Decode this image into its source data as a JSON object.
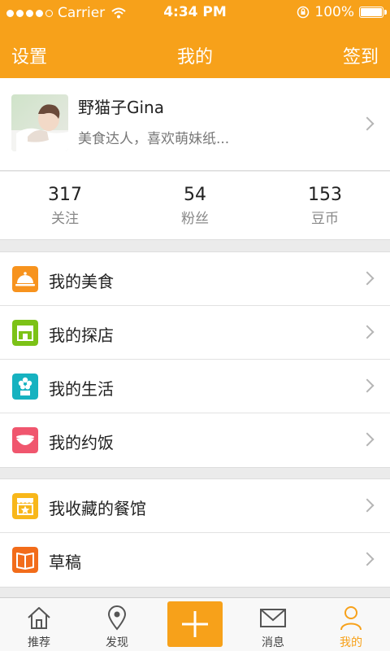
{
  "status_bar": {
    "carrier": "Carrier",
    "time": "4:34 PM",
    "battery": "100%",
    "signal_bars": 4
  },
  "nav": {
    "left": "设置",
    "title": "我的",
    "right": "签到"
  },
  "profile": {
    "name": "野猫子Gina",
    "bio": "美食达人，喜欢萌妹纸..."
  },
  "stats": [
    {
      "value": "317",
      "label": "关注"
    },
    {
      "value": "54",
      "label": "粉丝"
    },
    {
      "value": "153",
      "label": "豆币"
    }
  ],
  "menu_group_1": [
    {
      "label": "我的美食",
      "icon": "food-cloche-icon",
      "color": "#f7931e"
    },
    {
      "label": "我的探店",
      "icon": "shop-icon",
      "color": "#7cc217"
    },
    {
      "label": "我的生活",
      "icon": "flower-pot-icon",
      "color": "#16b2c0"
    },
    {
      "label": "我的约饭",
      "icon": "bowl-icon",
      "color": "#f0566e"
    }
  ],
  "menu_group_2": [
    {
      "label": "我收藏的餐馆",
      "icon": "favorite-restaurant-icon",
      "color": "#f8b71a"
    },
    {
      "label": "草稿",
      "icon": "book-icon",
      "color": "#f26c1a"
    }
  ],
  "tabbar": [
    {
      "label": "推荐",
      "icon": "home-icon",
      "active": false
    },
    {
      "label": "发现",
      "icon": "location-pin-icon",
      "active": false
    },
    {
      "label": "",
      "icon": "plus-icon",
      "active": false
    },
    {
      "label": "消息",
      "icon": "envelope-icon",
      "active": false
    },
    {
      "label": "我的",
      "icon": "person-icon",
      "active": true
    }
  ],
  "colors": {
    "accent": "#f7a11a",
    "background": "#ebebeb"
  }
}
